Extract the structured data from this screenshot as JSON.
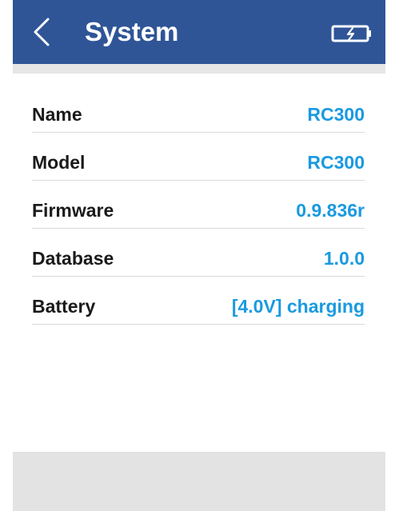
{
  "header": {
    "title": "System",
    "back_icon": "chevron-left-icon",
    "battery_icon": "battery-charging-icon"
  },
  "colors": {
    "header_bg": "#2f5597",
    "label": "#1a1a1a",
    "value": "#1a9ae0",
    "footer_bg": "#e3e3e3"
  },
  "rows": [
    {
      "label": "Name",
      "value": "RC300"
    },
    {
      "label": "Model",
      "value": "RC300"
    },
    {
      "label": "Firmware",
      "value": "0.9.836r"
    },
    {
      "label": "Database",
      "value": "1.0.0"
    },
    {
      "label": "Battery",
      "value": "[4.0V] charging"
    }
  ]
}
